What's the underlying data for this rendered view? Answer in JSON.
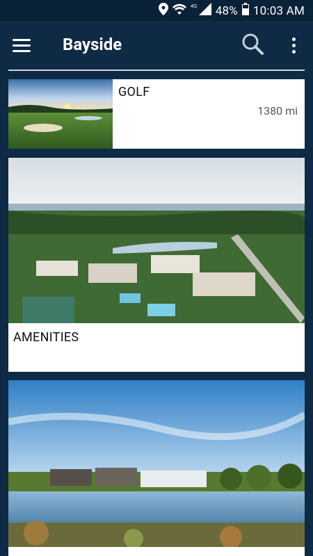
{
  "status_bar": {
    "icons": [
      "location-icon",
      "wifi-icon",
      "signal-4g-icon",
      "battery-icon"
    ],
    "network_label": "4G",
    "battery": "48%",
    "time": "10:03 AM"
  },
  "appbar": {
    "title": "Bayside",
    "icons": [
      "menu-icon",
      "search-icon",
      "more-vert-icon"
    ]
  },
  "cards": [
    {
      "label": "GOLF",
      "distance": "1380 mi",
      "image": "golf course photo"
    },
    {
      "label": "AMENITIES",
      "image": "aerial community photo"
    },
    {
      "label": "",
      "image": "lakeside homes photo"
    }
  ],
  "colors": {
    "background": "#0e2a44",
    "status_bar": "#0a2238",
    "card": "#ffffff",
    "divider": "#d0d6dc"
  }
}
